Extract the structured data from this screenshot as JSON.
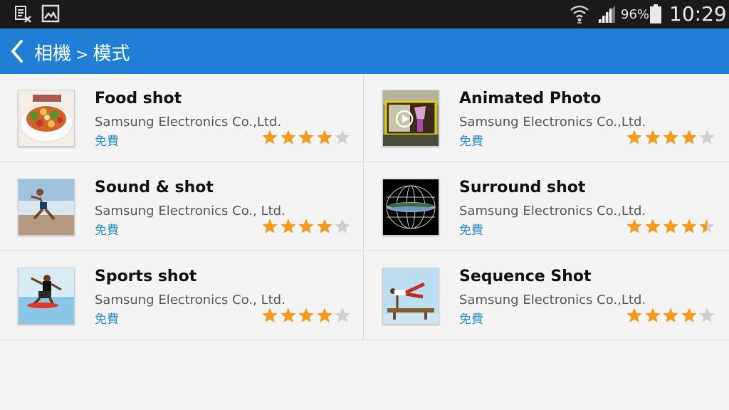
{
  "status_bar": {
    "left_icons": [
      "sim-card-missing-icon",
      "image-notification-icon"
    ],
    "right_icons": [
      "wifi-icon",
      "cellular-signal-icon",
      "battery-icon"
    ],
    "battery_percent": "96%",
    "time": "10:29"
  },
  "action_bar": {
    "back_icon": "chevron-left-icon",
    "breadcrumb_parent": "相機",
    "separator": ">",
    "breadcrumb_current": "模式",
    "background_color": "#1f7fd6"
  },
  "modes": [
    {
      "name": "Food shot",
      "developer": "Samsung Electronics Co.,Ltd.",
      "price": "免費",
      "rating": 4,
      "thumbnail": "food-thumbnail"
    },
    {
      "name": "Animated Photo",
      "developer": "Samsung Electronics Co.,Ltd.",
      "price": "免費",
      "rating": 4,
      "thumbnail": "animated-photo-thumbnail"
    },
    {
      "name": "Sound & shot",
      "developer": "Samsung Electronics Co., Ltd.",
      "price": "免費",
      "rating": 4,
      "thumbnail": "sound-and-shot-thumbnail"
    },
    {
      "name": "Surround shot",
      "developer": "Samsung Electronics Co.,Ltd.",
      "price": "免費",
      "rating": 4.5,
      "thumbnail": "surround-shot-thumbnail"
    },
    {
      "name": "Sports shot",
      "developer": "Samsung Electronics Co., Ltd.",
      "price": "免費",
      "rating": 4,
      "thumbnail": "sports-shot-thumbnail"
    },
    {
      "name": "Sequence Shot",
      "developer": "Samsung Electronics Co.,Ltd.",
      "price": "免費",
      "rating": 4,
      "thumbnail": "sequence-shot-thumbnail"
    }
  ],
  "colors": {
    "star_filled": "#f59a1b",
    "star_empty": "#cfcfcf",
    "price": "#2a8fd8"
  }
}
